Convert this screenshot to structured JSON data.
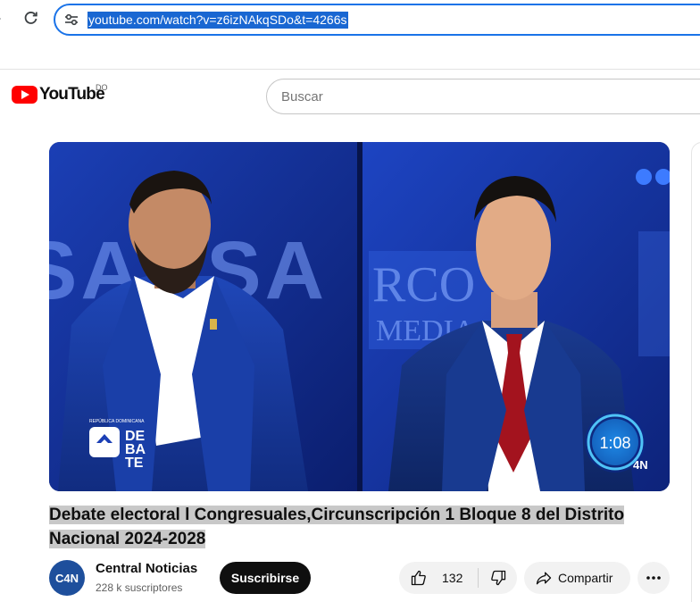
{
  "browser": {
    "url": "youtube.com/watch?v=z6izNAkqSDo&t=4266s"
  },
  "masthead": {
    "logo_text": "YouTube",
    "country_code": "DO",
    "search_placeholder": "Buscar"
  },
  "player": {
    "overlay_left_words": "SAUSA",
    "overlay_sign_line1": "RCO",
    "overlay_sign_line2": "MEDIA",
    "logo_country": "REPÚBLICA DOMINICANA",
    "logo_debate_line1": "DE",
    "logo_debate_line2": "BA",
    "logo_debate_line3": "TE",
    "timer": "1:08",
    "corner_brand": "4N"
  },
  "video": {
    "title": "Debate electoral l Congresuales,Circunscripción 1 Bloque 8 del Distrito Nacional 2024-2028"
  },
  "owner": {
    "avatar_text": "C4N",
    "channel_name": "Central Noticias",
    "subscribers": "228 k suscriptores",
    "subscribe_label": "Suscribirse"
  },
  "actions": {
    "like_count": "132",
    "share_label": "Compartir"
  },
  "colors": {
    "brand_red": "#ff0000",
    "url_highlight": "#1967d2",
    "omnibox_border": "#1a73e8",
    "studio_blue": "#1538a8",
    "timer_blue": "#1e88e5"
  }
}
